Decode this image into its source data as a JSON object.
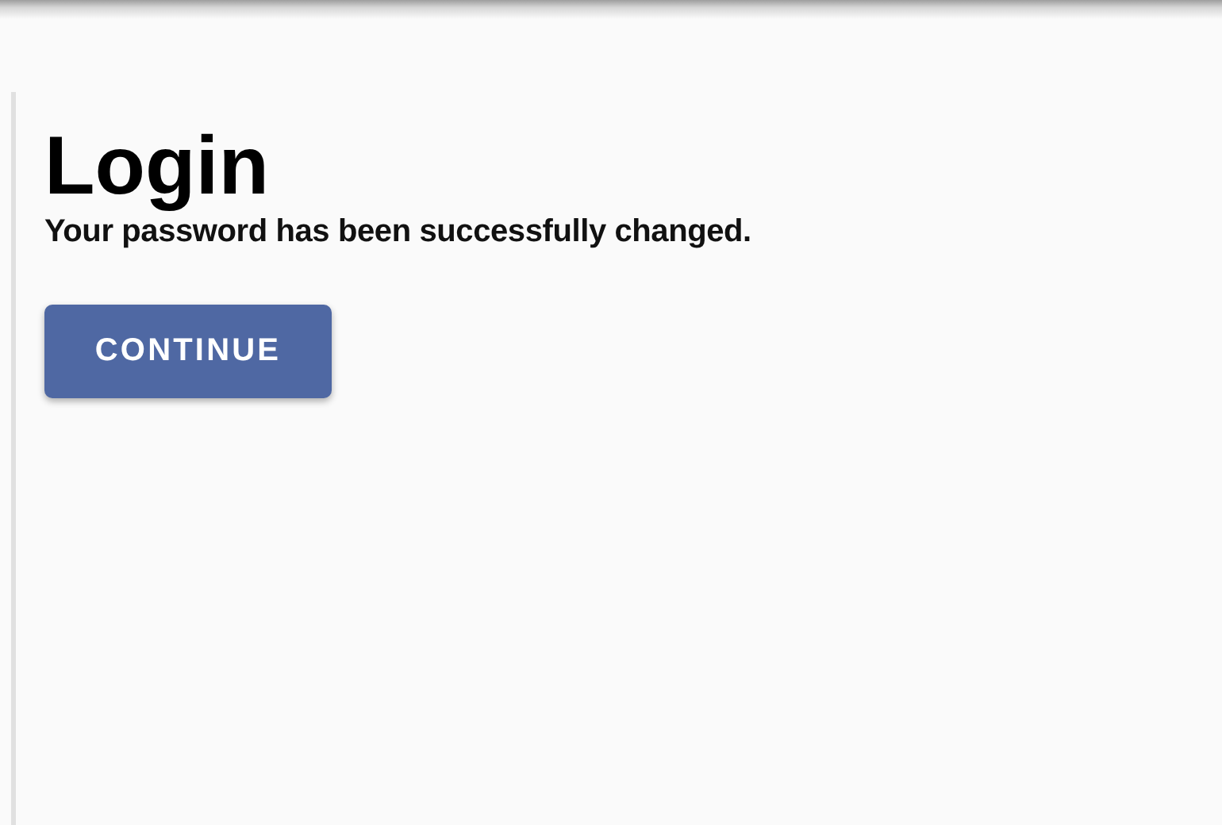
{
  "page": {
    "title": "Login",
    "message": "Your password has been successfully changed."
  },
  "buttons": [
    {
      "label": "CONTINUE",
      "kind": "primary"
    }
  ]
}
